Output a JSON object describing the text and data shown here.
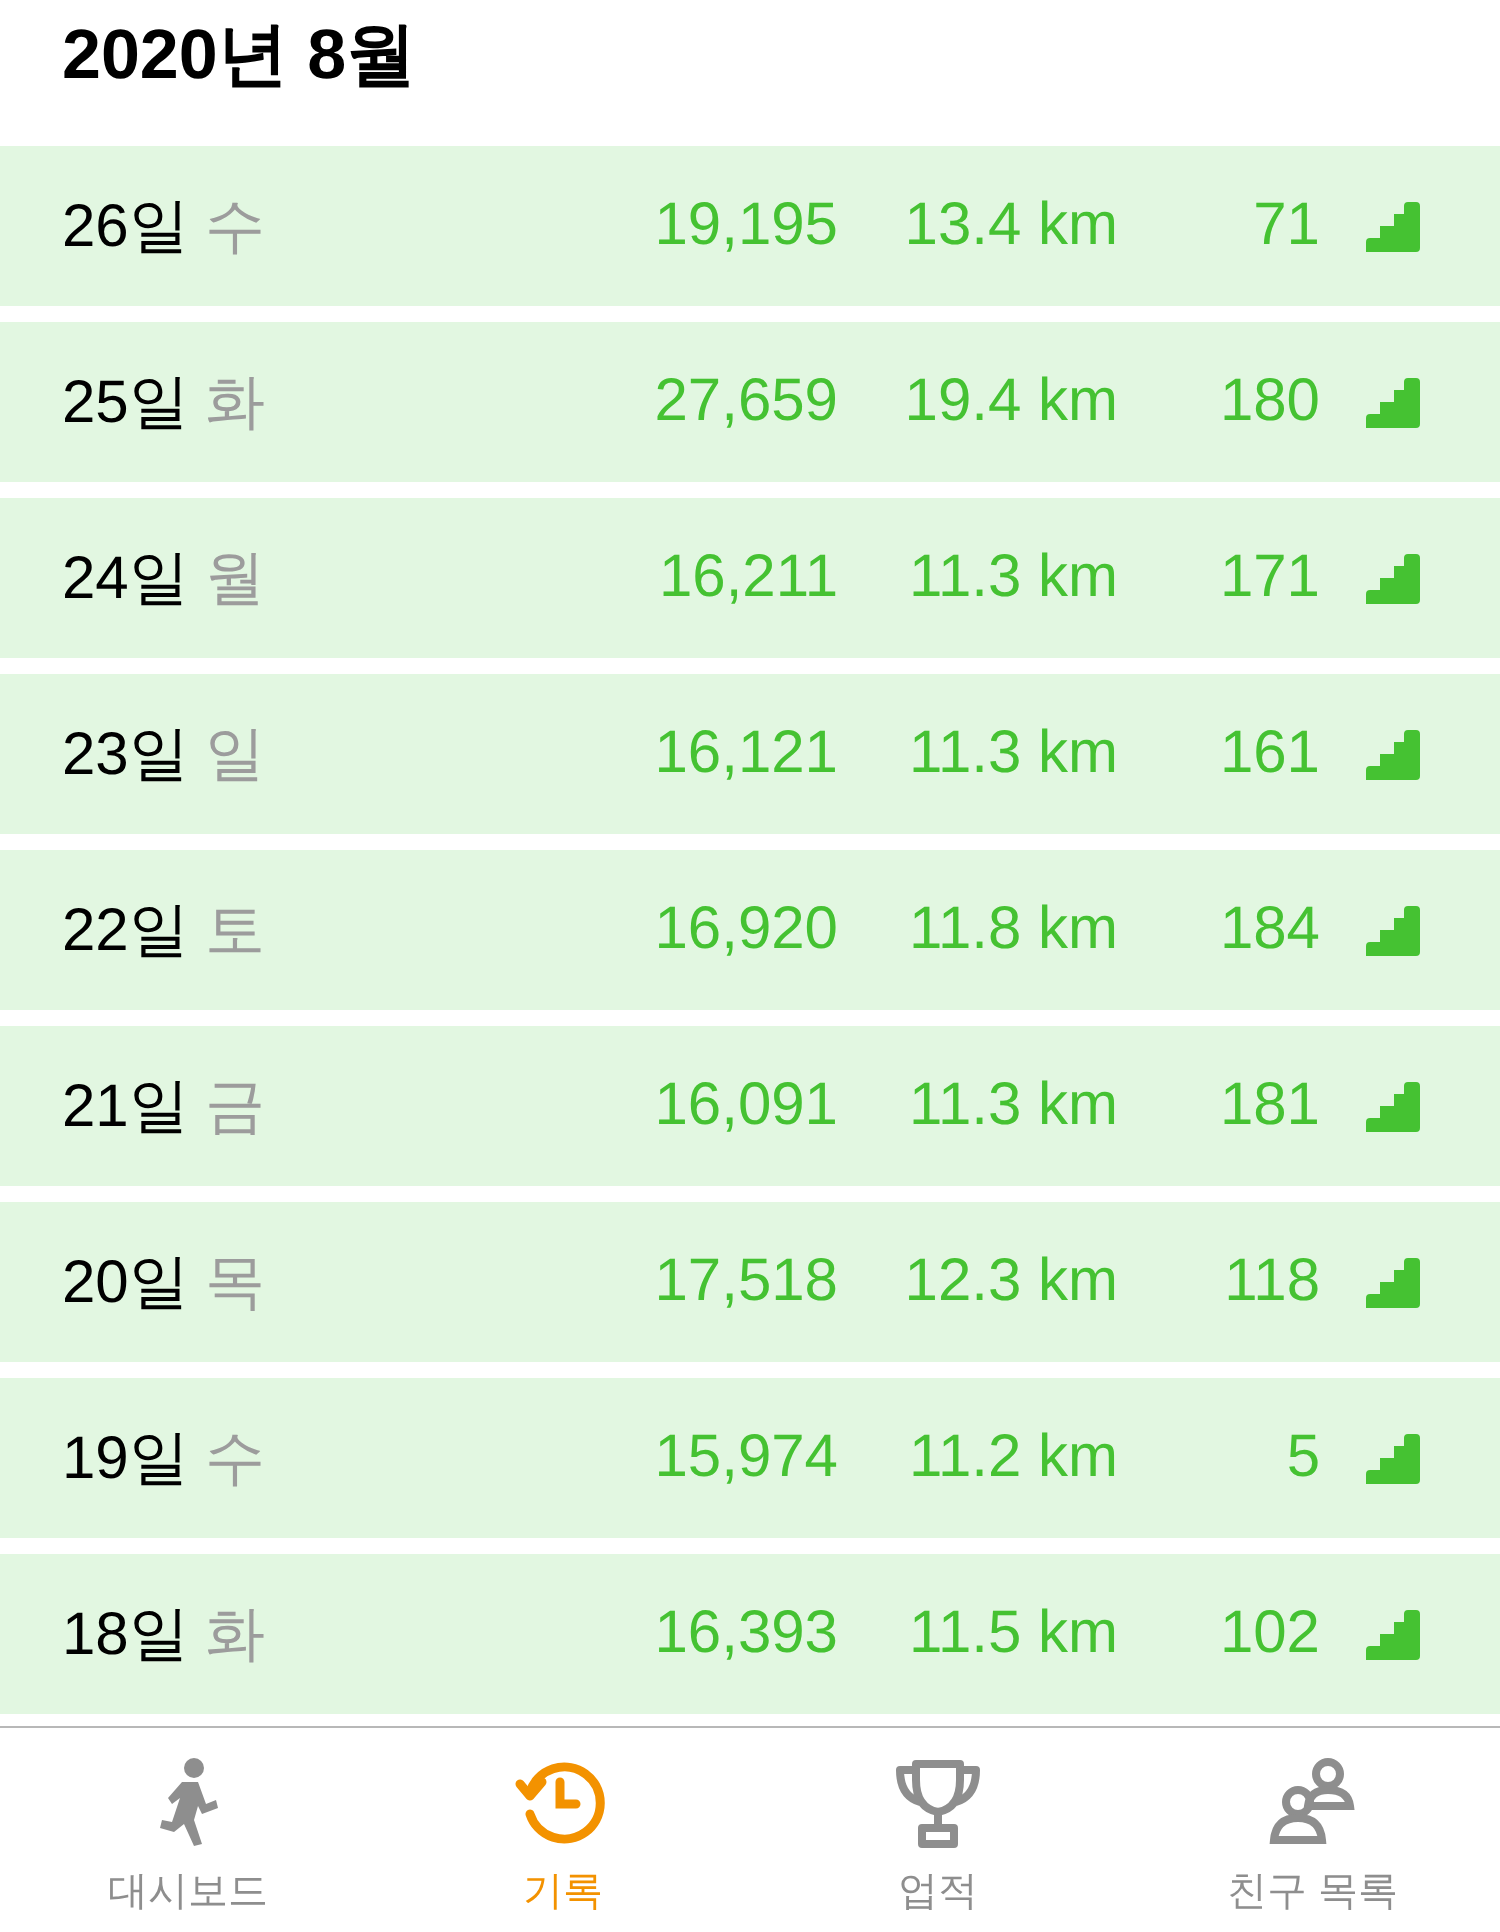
{
  "title": "2020년 8월",
  "rows": [
    {
      "day": "26일",
      "weekday": "수",
      "steps": "19,195",
      "distance": "13.4 km",
      "floors": "71"
    },
    {
      "day": "25일",
      "weekday": "화",
      "steps": "27,659",
      "distance": "19.4 km",
      "floors": "180"
    },
    {
      "day": "24일",
      "weekday": "월",
      "steps": "16,211",
      "distance": "11.3 km",
      "floors": "171"
    },
    {
      "day": "23일",
      "weekday": "일",
      "steps": "16,121",
      "distance": "11.3 km",
      "floors": "161"
    },
    {
      "day": "22일",
      "weekday": "토",
      "steps": "16,920",
      "distance": "11.8 km",
      "floors": "184"
    },
    {
      "day": "21일",
      "weekday": "금",
      "steps": "16,091",
      "distance": "11.3 km",
      "floors": "181"
    },
    {
      "day": "20일",
      "weekday": "목",
      "steps": "17,518",
      "distance": "12.3 km",
      "floors": "118"
    },
    {
      "day": "19일",
      "weekday": "수",
      "steps": "15,974",
      "distance": "11.2 km",
      "floors": "5"
    },
    {
      "day": "18일",
      "weekday": "화",
      "steps": "16,393",
      "distance": "11.5 km",
      "floors": "102"
    }
  ],
  "tabs": [
    {
      "kind": "runner",
      "label": "대시보드",
      "selected": false
    },
    {
      "kind": "history",
      "label": "기록",
      "selected": true
    },
    {
      "kind": "trophy",
      "label": "업적",
      "selected": false
    },
    {
      "kind": "friends",
      "label": "친구 목록",
      "selected": false
    }
  ]
}
